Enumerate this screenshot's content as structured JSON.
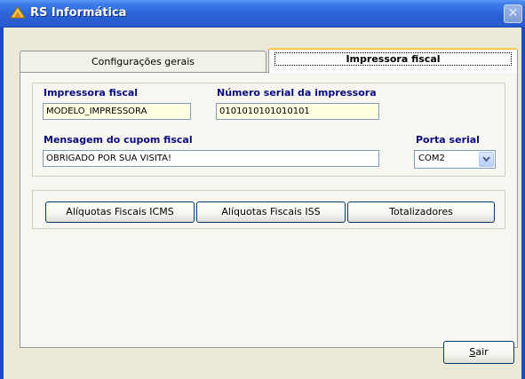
{
  "window": {
    "title": "RS Informática",
    "close_glyph": "✕"
  },
  "tabs": [
    {
      "label": "Configurações gerais",
      "active": false
    },
    {
      "label": "Impressora fiscal",
      "active": true
    }
  ],
  "fields": {
    "impressora": {
      "label": "Impressora fiscal",
      "value": "MODELO_IMPRESSORA"
    },
    "serial": {
      "label": "Número serial da impressora",
      "value": "0101010101010101"
    },
    "mensagem": {
      "label": "Mensagem do cupom fiscal",
      "value": "OBRIGADO POR SUA VISITA!"
    },
    "porta": {
      "label": "Porta serial",
      "value": "COM2"
    }
  },
  "buttons": {
    "icms": "Alíquotas Fiscais ICMS",
    "iss": "Alíquotas Fiscais ISS",
    "totalizadores": "Totalizadores",
    "sair_first": "S",
    "sair_rest": "air"
  },
  "icons": {
    "app": "triangle-app-icon",
    "close": "close-icon",
    "dropdown": "chevron-down-icon"
  },
  "colors": {
    "titlebar": "#2a5bcc",
    "label": "#0a0a80",
    "field_highlight": "#ffffe1",
    "active_tab_accent": "#ffc84b"
  }
}
